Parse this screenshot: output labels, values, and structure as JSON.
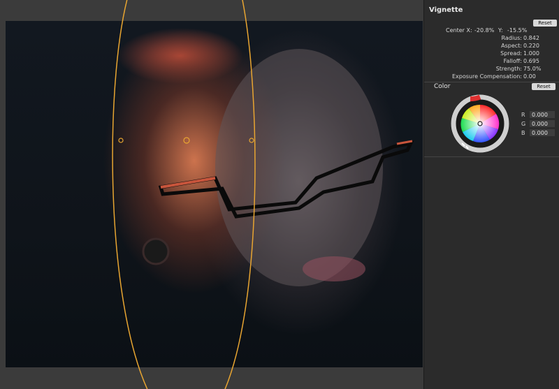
{
  "vignette": {
    "title": "Vignette",
    "reset_label": "Reset",
    "center": {
      "x_label": "Center X:",
      "x_value": "-20.8%",
      "y_label": "Y:",
      "y_value": "-15.5%"
    },
    "params": [
      {
        "label": "Radius:",
        "value": "0.842"
      },
      {
        "label": "Aspect:",
        "value": "0.220"
      },
      {
        "label": "Spread:",
        "value": "1.000"
      },
      {
        "label": "Falloff:",
        "value": "0.695"
      },
      {
        "label": "Strength:",
        "value": "75.0%"
      },
      {
        "label": "Exposure Compensation:",
        "value": "0.00"
      }
    ]
  },
  "color": {
    "title": "Color",
    "reset_label": "Reset",
    "r_label": "R",
    "r_value": "0.000",
    "g_label": "G",
    "g_value": "0.000",
    "b_label": "B",
    "b_value": "0.000"
  },
  "colors": {
    "overlay": "#e8a531",
    "panel_bg": "#2b2b2b",
    "viewer_bg": "#3b3b3b"
  }
}
